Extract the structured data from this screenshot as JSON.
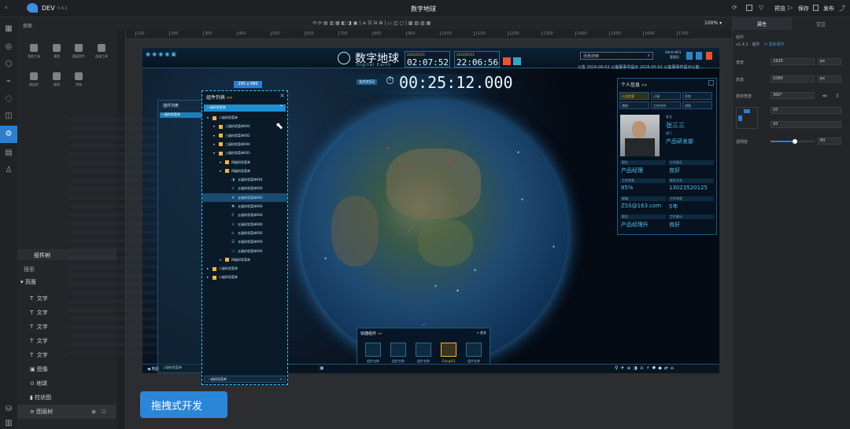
{
  "app": {
    "name": "DEV",
    "version": "0.4.2",
    "title": "数字地球",
    "zoom": "100%",
    "top_actions": [
      "预览",
      "保存",
      "发布"
    ]
  },
  "left": {
    "search_label": "搜索",
    "tools": [
      "导航工具",
      "漫游",
      "图层控件",
      "连接工具",
      "图层库",
      "量测",
      "特效"
    ],
    "tree": {
      "tab": "组件树",
      "search": "搜索",
      "root": "页面",
      "items": [
        "文字",
        "文字",
        "文字",
        "文字",
        "文字",
        "图像",
        "地球",
        "柱状图",
        "图层树"
      ]
    }
  },
  "scene": {
    "title": "数字地球",
    "subtitle": "Digital Earth",
    "clock1_date": "2022/05/21",
    "clock1_time": "02:07:52",
    "clock2_date": "2022/05/21",
    "clock2_time": "22:06:56",
    "timer_label": "实时时间",
    "timer": "00:25:12.000",
    "search_placeholder": "场景搜索",
    "user": {
      "name": "Admin001",
      "role": "管理员"
    },
    "notice": "公告  2016-06-02 以客服事件提示",
    "notice2": "2016-05-02 以客服事件提示以客...",
    "person": {
      "title": "个人信息",
      "tabs": [
        "人员信息",
        "订阅",
        "任务",
        "通知",
        "工作空间",
        "消息"
      ],
      "name_label": "姓名",
      "name": "张三三",
      "dept_label": "部门",
      "dept": "产品研发部",
      "fields": [
        {
          "label": "职位",
          "value": "产品经理"
        },
        {
          "label": "工作表示",
          "value": "良好"
        },
        {
          "label": "工作状态",
          "value": "85%"
        },
        {
          "label": "联系方式",
          "value": "13023520125"
        },
        {
          "label": "邮箱",
          "value": "ZSS@163.com"
        },
        {
          "label": "工作年限",
          "value": "5年"
        },
        {
          "label": "职位",
          "value": "产品经理升"
        },
        {
          "label": "工作表示",
          "value": "良好"
        }
      ]
    },
    "quick": {
      "title": "快捷组件",
      "more": "+ 更多",
      "items": [
        "组件名称",
        "组件名称",
        "组件名称",
        "Group01",
        "组件名称"
      ]
    },
    "bottom_left": "地图",
    "bottom_mid": "管理"
  },
  "plugin_list": {
    "title": "组件列表",
    "size": "295 x 986",
    "header": "一级树状菜单",
    "bottom": "一级树状菜单",
    "rows": [
      {
        "level": 1,
        "text": "二级树状菜单"
      },
      {
        "level": 2,
        "text": "三级树状菜单004"
      },
      {
        "level": 2,
        "text": "三级树状菜单002"
      },
      {
        "level": 2,
        "text": "三级树状菜单004"
      },
      {
        "level": 2,
        "text": "三级树状菜单003"
      },
      {
        "level": 3,
        "text": "四级树状菜单"
      },
      {
        "level": 3,
        "text": "四级树状菜单"
      },
      {
        "level": 4,
        "text": "五级树状菜单004"
      },
      {
        "level": 4,
        "text": "五级树状菜单004"
      },
      {
        "level": 4,
        "text": "五级树状菜单003"
      },
      {
        "level": 4,
        "text": "五级树状菜单004"
      },
      {
        "level": 4,
        "text": "五级树状菜单004"
      },
      {
        "level": 4,
        "text": "五级树状菜单004"
      },
      {
        "level": 4,
        "text": "五级树状菜单004"
      },
      {
        "level": 4,
        "text": "五级树状菜单004"
      },
      {
        "level": 4,
        "text": "五级树状菜单004"
      },
      {
        "level": 3,
        "text": "四级树状菜单"
      },
      {
        "level": 1,
        "text": "二级树状菜单"
      },
      {
        "level": 1,
        "text": "二级树状菜单"
      }
    ]
  },
  "ghost_panel": {
    "title": "插件列表",
    "tab": "一级树状菜单",
    "footer": "二级树状菜单"
  },
  "badge": "拖拽式开发",
  "right": {
    "tabs": [
      "属性",
      "交互"
    ],
    "section": "组件",
    "version": "v1.4.2 · 组件",
    "update": "更新组件",
    "width_label": "宽度",
    "width": "1920",
    "height_label": "高度",
    "height": "1080",
    "rotate_label": "旋转角度",
    "rotate": "360°",
    "pad1": "10",
    "pad2": "10",
    "opacity_label": "透明度",
    "opacity": "60",
    "unit": "px",
    "opacity_unit": "%",
    "opacity_level": 0.55
  },
  "ruler": [
    "100",
    "200",
    "300",
    "400",
    "500",
    "600",
    "700",
    "800",
    "900",
    "1000",
    "1100",
    "1200",
    "1300",
    "1400",
    "1500",
    "1600",
    "1700"
  ],
  "colors": {
    "accent": "#2a7fd1",
    "cyan": "#39c7ff",
    "gold": "#f2b63c"
  }
}
